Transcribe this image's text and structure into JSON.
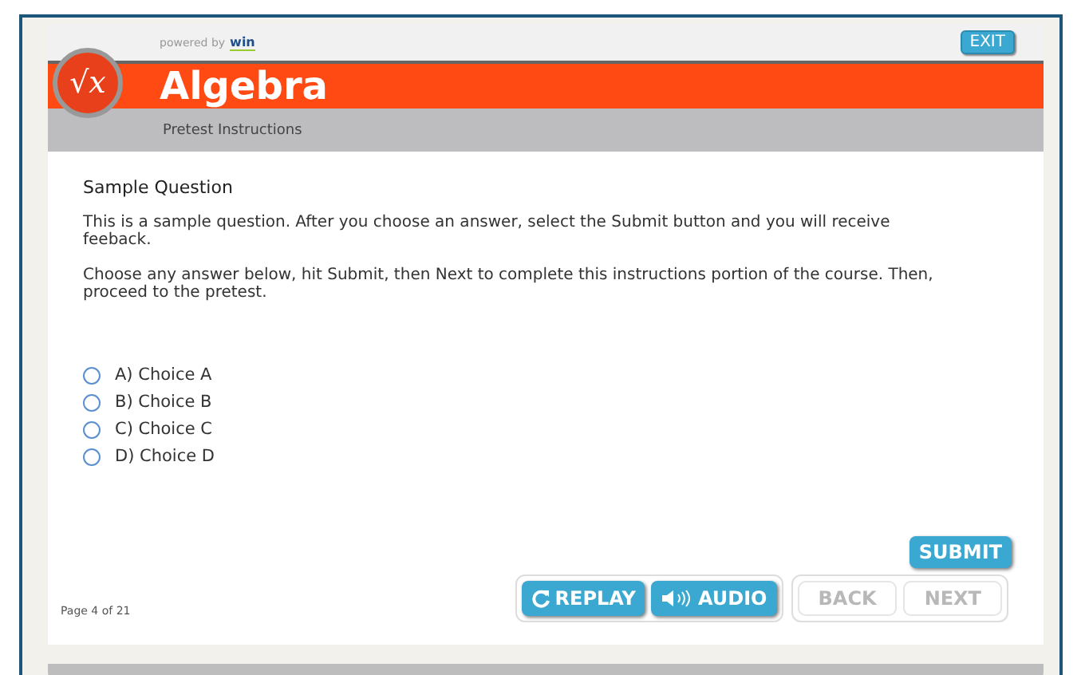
{
  "header": {
    "powered_by": "powered by",
    "brand": "win",
    "exit": "EXIT",
    "title": "Algebra",
    "logo": "√x",
    "subtitle": "Pretest Instructions"
  },
  "content": {
    "heading": "Sample Question",
    "paragraphs": [
      "This is a sample question. After you choose an answer, select the Submit button and you will receive feeback.",
      "Choose any answer below, hit Submit, then Next to complete this instructions portion of the course. Then, proceed to the pretest."
    ],
    "choices": [
      {
        "label": "A) Choice A",
        "selected": false
      },
      {
        "label": "B) Choice B",
        "selected": false
      },
      {
        "label": "C) Choice C",
        "selected": false
      },
      {
        "label": "D) Choice D",
        "selected": false
      }
    ],
    "submit": "SUBMIT"
  },
  "footer": {
    "page": "Page 4 of 21",
    "media_buttons": [
      {
        "kind": "replay",
        "label": "REPLAY"
      },
      {
        "kind": "audio",
        "label": "AUDIO"
      }
    ],
    "nav_buttons": [
      {
        "label": "BACK",
        "disabled": true
      },
      {
        "label": "NEXT",
        "disabled": true
      }
    ]
  }
}
